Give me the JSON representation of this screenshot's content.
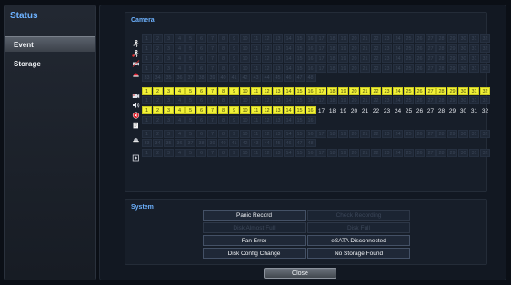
{
  "sidebar": {
    "title": "Status",
    "items": [
      {
        "label": "Event",
        "active": true
      },
      {
        "label": "Storage",
        "active": false
      }
    ]
  },
  "camera": {
    "label": "Camera",
    "rows": [
      {
        "icon": "motion-icon",
        "cells": [
          "1",
          "2",
          "3",
          "4",
          "5",
          "6",
          "7",
          "8",
          "9",
          "10",
          "11",
          "12",
          "13",
          "14",
          "15",
          "16",
          "17",
          "18",
          "19",
          "20",
          "21",
          "22",
          "23",
          "24",
          "25",
          "26",
          "27",
          "28",
          "29",
          "30",
          "31",
          "32"
        ],
        "states": ""
      },
      {
        "icon": "motion-alert-icon",
        "cells": [
          "1",
          "2",
          "3",
          "4",
          "5",
          "6",
          "7",
          "8",
          "9",
          "10",
          "11",
          "12",
          "13",
          "14",
          "15",
          "16",
          "17",
          "18",
          "19",
          "20",
          "21",
          "22",
          "23",
          "24",
          "25",
          "26",
          "27",
          "28",
          "29",
          "30",
          "31",
          "32"
        ],
        "states": ""
      },
      {
        "icon": "camera-tamper-icon",
        "cells": [
          "1",
          "2",
          "3",
          "4",
          "5",
          "6",
          "7",
          "8",
          "9",
          "10",
          "11",
          "12",
          "13",
          "14",
          "15",
          "16",
          "17",
          "18",
          "19",
          "20",
          "21",
          "22",
          "23",
          "24",
          "25",
          "26",
          "27",
          "28",
          "29",
          "30",
          "31",
          "32"
        ],
        "states": ""
      },
      {
        "icon": "alarm-sensor-icon",
        "cells": [
          "1",
          "2",
          "3",
          "4",
          "5",
          "6",
          "7",
          "8",
          "9",
          "10",
          "11",
          "12",
          "13",
          "14",
          "15",
          "16",
          "17",
          "18",
          "19",
          "20",
          "21",
          "22",
          "23",
          "24",
          "25",
          "26",
          "27",
          "28",
          "29",
          "30",
          "31",
          "32"
        ],
        "states": ""
      },
      {
        "icon": "",
        "cells": [
          "33",
          "34",
          "35",
          "36",
          "37",
          "38",
          "39",
          "40",
          "41",
          "42",
          "43",
          "44",
          "45",
          "46",
          "47",
          "48"
        ],
        "states": ""
      },
      {
        "icon": "video-record-icon",
        "cells": [
          "1",
          "2",
          "3",
          "4",
          "5",
          "6",
          "7",
          "8",
          "9",
          "10",
          "11",
          "12",
          "13",
          "14",
          "15",
          "16",
          "17",
          "18",
          "19",
          "20",
          "21",
          "22",
          "23",
          "24",
          "25",
          "26",
          "27",
          "28",
          "29",
          "30",
          "31",
          "32"
        ],
        "states": "all-on"
      },
      {
        "icon": "audio-icon",
        "cells": [
          "1",
          "2",
          "3",
          "4",
          "5",
          "6",
          "7",
          "8",
          "9",
          "10",
          "11",
          "12",
          "13",
          "14",
          "15",
          "16",
          "17",
          "18",
          "19",
          "20",
          "21",
          "22",
          "23",
          "24",
          "25",
          "26",
          "27",
          "28",
          "29",
          "30",
          "31",
          "32"
        ],
        "states": ""
      },
      {
        "icon": "video-loss-icon",
        "cells": [
          "1",
          "2",
          "3",
          "4",
          "5",
          "6",
          "7",
          "8",
          "9",
          "10",
          "11",
          "12",
          "13",
          "14",
          "15",
          "16",
          "17",
          "18",
          "19",
          "20",
          "21",
          "22",
          "23",
          "24",
          "25",
          "26",
          "27",
          "28",
          "29",
          "30",
          "31",
          "32"
        ],
        "states": "first-16-on-rest-plain"
      },
      {
        "icon": "text-event-icon",
        "cells": [
          "1",
          "2",
          "3",
          "4",
          "5",
          "6",
          "7",
          "8",
          "9",
          "10",
          "11",
          "12",
          "13",
          "14",
          "15",
          "16"
        ],
        "states": ""
      },
      {
        "icon": "alarm-out-icon",
        "cells": [
          "1",
          "2",
          "3",
          "4",
          "5",
          "6",
          "7",
          "8",
          "9",
          "10",
          "11",
          "12",
          "13",
          "14",
          "15",
          "16",
          "17",
          "18",
          "19",
          "20",
          "21",
          "22",
          "23",
          "24",
          "25",
          "26",
          "27",
          "28",
          "29",
          "30",
          "31",
          "32"
        ],
        "states": ""
      },
      {
        "icon": "",
        "cells": [
          "33",
          "34",
          "35",
          "36",
          "37",
          "38",
          "39",
          "40",
          "41",
          "42",
          "43",
          "44",
          "45",
          "46",
          "47",
          "48"
        ],
        "states": ""
      },
      {
        "icon": "network-out-icon",
        "cells": [
          "1",
          "2",
          "3",
          "4",
          "5",
          "6",
          "7",
          "8",
          "9",
          "10",
          "11",
          "12",
          "13",
          "14",
          "15",
          "16",
          "17",
          "18",
          "19",
          "20",
          "21",
          "22",
          "23",
          "24",
          "25",
          "26",
          "27",
          "28",
          "29",
          "30",
          "31",
          "32"
        ],
        "states": ""
      }
    ]
  },
  "system": {
    "label": "System",
    "buttons": [
      {
        "label": "Panic Record",
        "active": true
      },
      {
        "label": "Check Recording",
        "active": false
      },
      {
        "label": "Disk Almost Full",
        "active": false
      },
      {
        "label": "Disk Full",
        "active": false
      },
      {
        "label": "Fan Error",
        "active": true
      },
      {
        "label": "eSATA Disconnected",
        "active": true
      },
      {
        "label": "Disk Config Change",
        "active": true
      },
      {
        "label": "No Storage Found",
        "active": true
      }
    ]
  },
  "close_label": "Close",
  "colors": {
    "accent": "#6db2ff",
    "active_cell": "#f1f137",
    "inactive_cell": "#1f2836"
  }
}
